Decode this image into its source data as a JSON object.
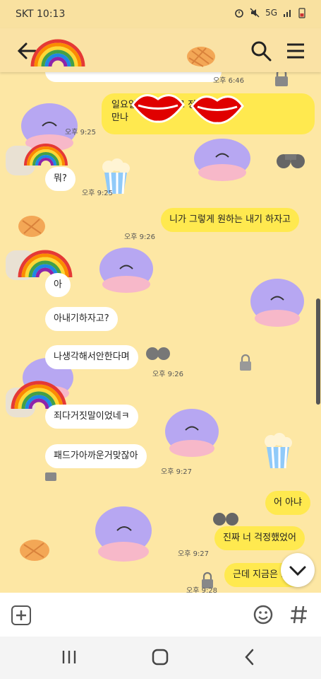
{
  "status_bar": {
    "carrier": "SKT",
    "time": "10:13",
    "network": "5G"
  },
  "messages": [
    {
      "type": "time",
      "text": "오후 6:46"
    },
    {
      "type": "out",
      "text": "일요일에 엄마 학교 정문 앞에서"
    },
    {
      "type": "out_line2",
      "text": "만나"
    },
    {
      "type": "time",
      "text": "오후 9:25"
    },
    {
      "type": "in",
      "text": "뭐?"
    },
    {
      "type": "time",
      "text": "오후 9:25"
    },
    {
      "type": "out",
      "text": "니가 그렇게 원하는 내기 하자고"
    },
    {
      "type": "time",
      "text": "오후 9:26"
    },
    {
      "type": "in",
      "text": "아"
    },
    {
      "type": "in",
      "text": "아내기하자고?"
    },
    {
      "type": "in",
      "text": "나생각해서안한다며"
    },
    {
      "type": "time",
      "text": "오후 9:26"
    },
    {
      "type": "in",
      "text": "죄다거짓말이었네ㅋ"
    },
    {
      "type": "in",
      "text": "패드가아까운거맞잖아"
    },
    {
      "type": "time",
      "text": "오후 9:27"
    },
    {
      "type": "out",
      "text": "어 아냐"
    },
    {
      "type": "out",
      "text": "진짜 너 걱정했었어"
    },
    {
      "type": "time",
      "text": "오후 9:27"
    },
    {
      "type": "out",
      "text": "근데 지금은 ..."
    },
    {
      "type": "time",
      "text": "오후 9:28"
    }
  ],
  "colors": {
    "bubble_out": "#ffe94f",
    "bubble_in": "#ffffff",
    "background": "#fde7a4",
    "header": "#fae2a5"
  },
  "icons": [
    "back-arrow-icon",
    "search-icon",
    "menu-icon",
    "plus-icon",
    "emoji-icon",
    "hashtag-icon",
    "scroll-down-icon"
  ],
  "nav": {
    "recent": "|||",
    "home": "○",
    "back": "<"
  }
}
